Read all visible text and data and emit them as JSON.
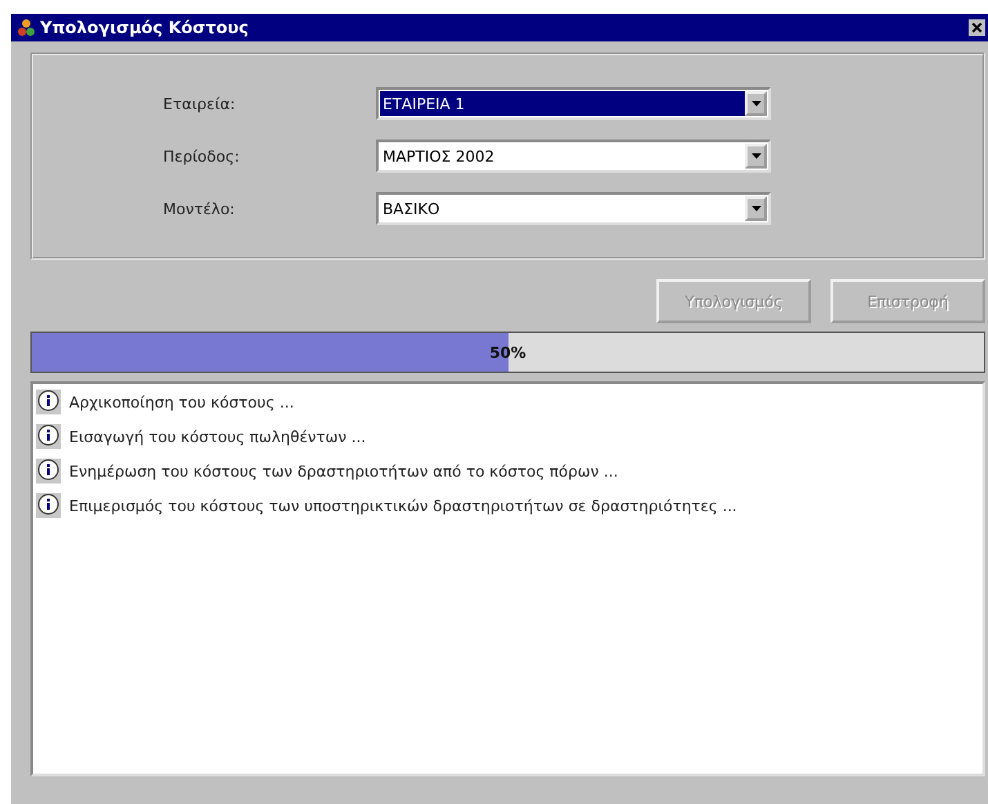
{
  "window": {
    "title": "Υπολογισμός Κόστους"
  },
  "fields": [
    {
      "label": "Εταιρεία:",
      "value": "ΕΤΑΙΡΕΙΑ 1",
      "selected": true
    },
    {
      "label": "Περίοδος:",
      "value": "ΜΑΡΤΙΟΣ 2002",
      "selected": false
    },
    {
      "label": "Μοντέλο:",
      "value": "ΒΑΣΙΚΟ",
      "selected": false
    }
  ],
  "buttons": [
    {
      "label": "Υπολογισμός",
      "disabled": true
    },
    {
      "label": "Επιστροφή",
      "disabled": true
    }
  ],
  "progress": {
    "level": 0.5,
    "reading": "50%"
  },
  "log": [
    "Αρχικοποίηση του κόστους ...",
    "Εισαγωγή του κόστους πωληθέντων ...",
    "Ενημέρωση του κόστους των δραστηριοτήτων από το κόστος πόρων ...",
    "Επιμερισμός του κόστους των υποστηρικτικών δραστηριοτήτων σε δραστηριότητες ..."
  ]
}
